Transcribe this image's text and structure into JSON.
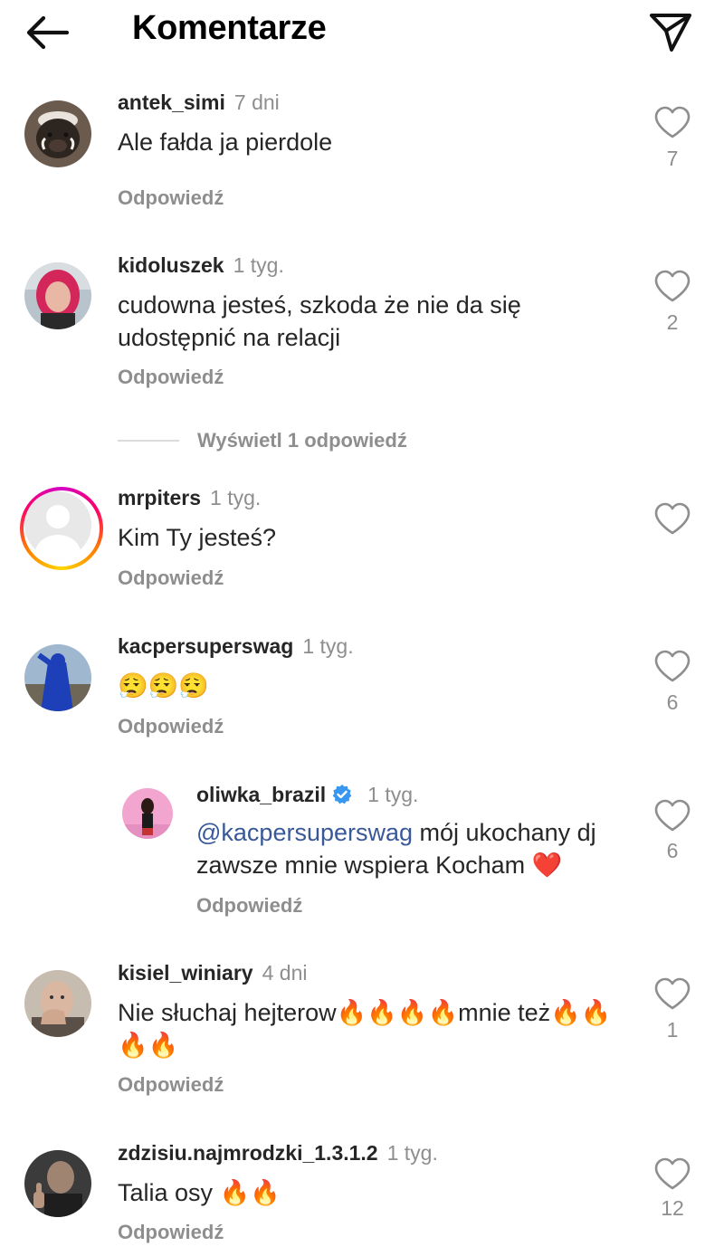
{
  "header": {
    "title": "Komentarze",
    "back_icon": "arrow-left-icon",
    "send_icon": "paper-plane-icon"
  },
  "reply_label": "Odpowiedź",
  "colors": {
    "text_primary": "#262626",
    "text_secondary": "#8e8e8e",
    "mention": "#385898",
    "verified": "#3897f0",
    "story_ring": [
      "#d300c5",
      "#ff0069",
      "#ff7a00",
      "#ffd600"
    ]
  },
  "comments": [
    {
      "username": "antek_simi",
      "time": "7 dni",
      "text": "Ale fałda ja pierdole",
      "likes": "7",
      "avatar": "boar-avatar"
    },
    {
      "username": "kidoluszek",
      "time": "1 tyg.",
      "text": "cudowna jesteś, szkoda że nie da się udostępnić na relacji",
      "likes": "2",
      "avatar": "pink-hair-avatar"
    },
    {
      "username": "mrpiters",
      "time": "1 tyg.",
      "text": "Kim Ty jesteś?",
      "likes": "",
      "avatar": "default-avatar"
    },
    {
      "username": "kacpersuperswag",
      "time": "1 tyg.",
      "text": "😮‍💨😮‍💨😮‍💨",
      "likes": "6",
      "avatar": "blue-hoodie-avatar"
    },
    {
      "username": "oliwka_brazil",
      "time": "1 tyg.",
      "mention": "@kacpersuperswag",
      "text": " mój ukochany dj zawsze mnie wspiera Kocham ❤️",
      "likes": "6",
      "avatar": "pink-wall-avatar",
      "verified": true
    },
    {
      "username": "kisiel_winiary",
      "time": "4 dni",
      "text": "Nie słuchaj hejterow🔥🔥🔥🔥mnie też🔥🔥🔥🔥",
      "likes": "1",
      "avatar": "man-avatar"
    },
    {
      "username": "zdzisiu.najmrodzki_1.3.1.2",
      "time": "1 tyg.",
      "text": "Talia osy 🔥🔥",
      "likes": "12",
      "avatar": "thumbs-up-avatar"
    }
  ],
  "view_replies": "Wyświetl 1 odpowiedź"
}
